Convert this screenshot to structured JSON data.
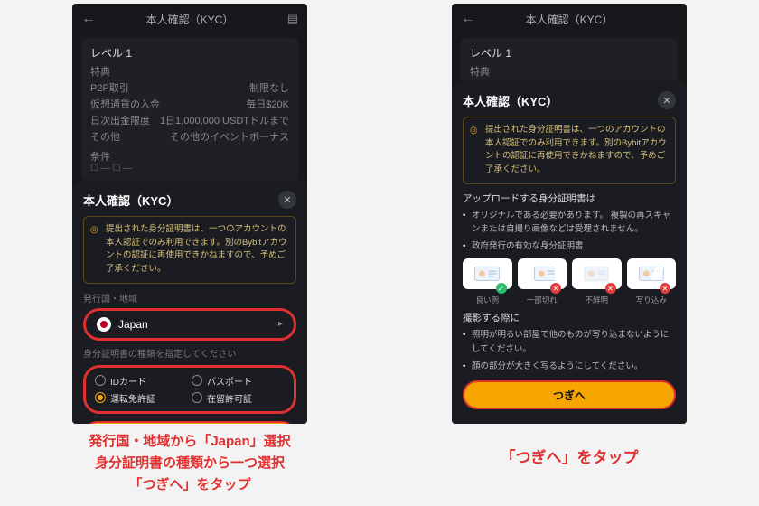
{
  "header": {
    "title": "本人確認（KYC）"
  },
  "level_card": {
    "level": "レベル 1",
    "perks_label": "特典",
    "rows": [
      {
        "k": "P2P取引",
        "v": "制限なし"
      },
      {
        "k": "仮想通貨の入金",
        "v": "毎日$20K"
      },
      {
        "k": "日次出金限度",
        "v": "1日1,000,000 USDTドルまで"
      },
      {
        "k": "その他",
        "v": "その他のイベントボーナス"
      }
    ],
    "req_label": "条件"
  },
  "sheet": {
    "title": "本人確認（KYC）",
    "notice": "提出された身分証明書は、一つのアカウントの本人認証でのみ利用できます。別のBybitアカウントの認証に再使用できかねますので、予めご了承ください。",
    "country_label": "発行国・地域",
    "country_value": "Japan",
    "doc_label": "身分証明書の種類を指定してください",
    "docs": {
      "id_card": "IDカード",
      "passport": "パスポート",
      "drivers": "運転免許証",
      "residence": "在留許可証"
    },
    "cta": "つぎへ"
  },
  "sheet2": {
    "upload_head": "アップロードする身分証明書は",
    "upload_bullets": [
      "オリジナルである必要があります。\n複製の再スキャンまたは自撮り画像などは受理されません。",
      "政府発行の有効な身分証明書"
    ],
    "cards": {
      "ok": "良い例",
      "cut": "一部切れ",
      "blur": "不鮮明",
      "glare": "写り込み"
    },
    "shoot_head": "撮影する際に",
    "shoot_bullets": [
      "照明が明るい部屋で他のものが写り込まないようにしてください。",
      "顔の部分が大きく写るようにしてください。"
    ]
  },
  "captions": {
    "left_1": "発行国・地域から「Japan」選択",
    "left_2": "身分証明書の種類から一つ選択",
    "left_3": "「つぎへ」をタップ",
    "right": "「つぎへ」をタップ"
  }
}
